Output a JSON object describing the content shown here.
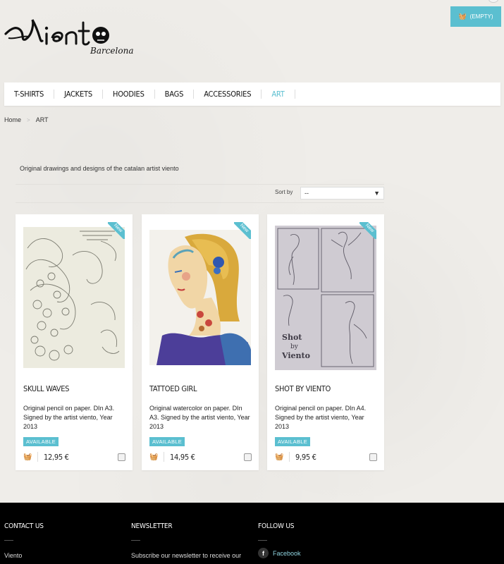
{
  "header": {
    "logo_text": "viento",
    "logo_sub": "Barcelona",
    "cart_label": "(EMPTY)"
  },
  "nav": {
    "items": [
      {
        "label": "T-SHIRTS"
      },
      {
        "label": "JACKETS"
      },
      {
        "label": "HOODIES"
      },
      {
        "label": "BAGS"
      },
      {
        "label": "ACCESSORIES"
      },
      {
        "label": "ART",
        "active": true
      }
    ]
  },
  "breadcrumb": {
    "home": "Home",
    "separator": ">",
    "current": "ART"
  },
  "category": {
    "description": "Original drawings and designs of the catalan artist viento"
  },
  "sort": {
    "label": "Sort by",
    "value": "--"
  },
  "products": [
    {
      "badge": "New",
      "name": "SKULL WAVES",
      "description": "Original pencil on paper. DIn A3. Signed by the artist viento, Year 2013",
      "availability": "AVAILABLE",
      "price": "12,95 €"
    },
    {
      "badge": "New",
      "name": "TATTOED GIRL",
      "description": "Original watercolor on paper. DIn A3. Signed by the artist viento, Year 2013",
      "availability": "AVAILABLE",
      "price": "14,95 €"
    },
    {
      "badge": "New",
      "name": "SHOT BY VIENTO",
      "description": "Original pencil on paper. DIn A4. Signed by the artist viento, Year 2013",
      "availability": "AVAILABLE",
      "price": "9,95 €"
    }
  ],
  "footer": {
    "contact_title": "CONTACT US",
    "contact_text": "Viento",
    "newsletter_title": "NEWSLETTER",
    "newsletter_text": "Subscribe our newsletter to receive our",
    "follow_title": "FOLLOW US",
    "facebook_label": "Facebook"
  },
  "colors": {
    "accent": "#5bbfd0",
    "background": "#efede9",
    "footer": "#000000"
  }
}
